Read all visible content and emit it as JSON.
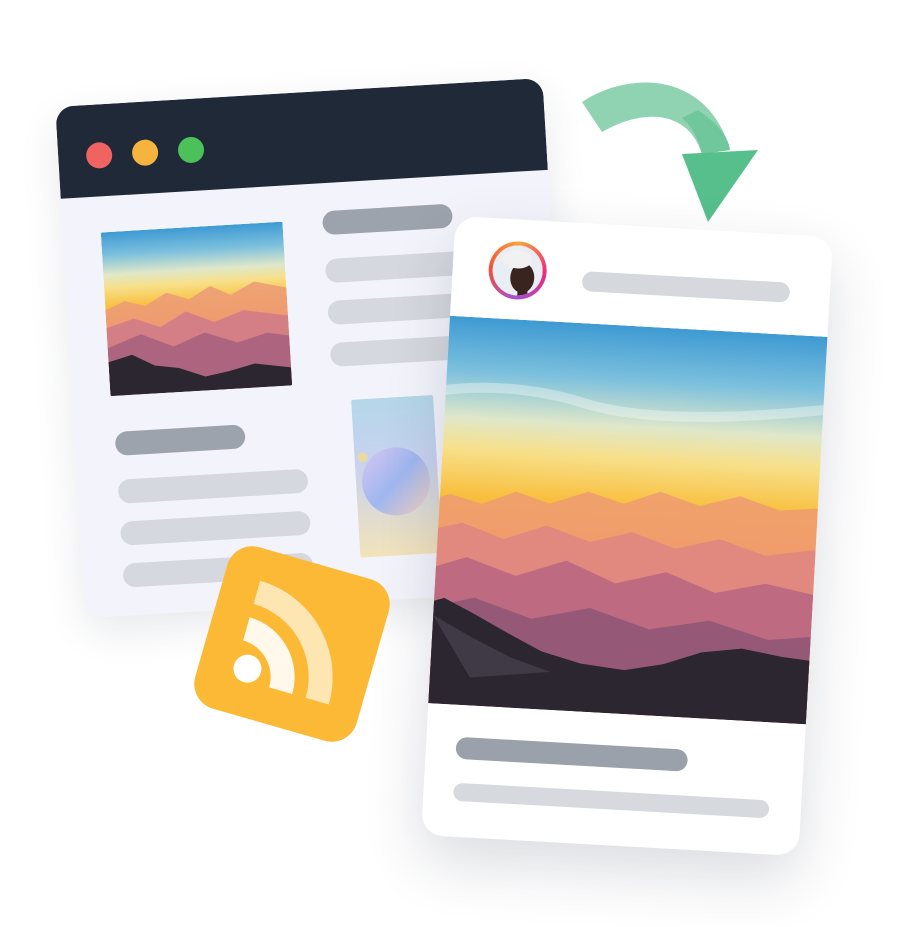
{
  "scene": {
    "browser": {
      "window_controls": [
        "close-dot",
        "minimize-dot",
        "maximize-dot"
      ],
      "control_colors": [
        "#ef6461",
        "#f5b43d",
        "#4cc15a"
      ],
      "titlebar_color": "#1f2937",
      "thumbnail": "mountain-sunset-image",
      "secondary_thumbnail": "gradient-orb-image"
    },
    "arrow": {
      "icon": "curved-arrow-icon",
      "color": "#57bf8c"
    },
    "rss": {
      "icon": "rss-feed-icon",
      "color": "#fbb935"
    },
    "post": {
      "avatar": "profile-avatar-image",
      "avatar_ring_colors": [
        "#f9a23c",
        "#ee2a7b",
        "#a24fd6"
      ],
      "image": "mountain-sunset-image"
    }
  }
}
